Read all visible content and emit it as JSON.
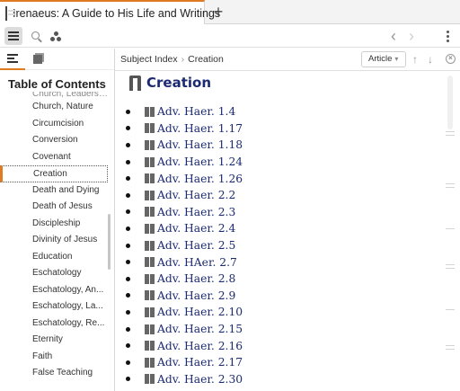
{
  "window": {
    "tab_title": "Irenaeus: A Guide to His Life and Writings",
    "new_tab_symbol": "+"
  },
  "toolbar": {
    "icons": [
      "hamburger-menu-icon",
      "search-icon",
      "triangle-dots-icon",
      "back-icon",
      "forward-icon",
      "more-vertical-icon"
    ],
    "back_symbol": "‹",
    "forward_symbol": "›"
  },
  "sidebar": {
    "title": "Table of Contents",
    "items": [
      {
        "label": "Church, Leadership"
      },
      {
        "label": "Church, Nature"
      },
      {
        "label": "Circumcision"
      },
      {
        "label": "Conversion"
      },
      {
        "label": "Covenant"
      },
      {
        "label": "Creation",
        "selected": true
      },
      {
        "label": "Death and Dying"
      },
      {
        "label": "Death of Jesus"
      },
      {
        "label": "Discipleship"
      },
      {
        "label": "Divinity of Jesus"
      },
      {
        "label": "Education"
      },
      {
        "label": "Eschatology"
      },
      {
        "label": "Eschatology, An..."
      },
      {
        "label": "Eschatology, La..."
      },
      {
        "label": "Eschatology, Re..."
      },
      {
        "label": "Eternity"
      },
      {
        "label": "Faith"
      },
      {
        "label": "False Teaching"
      }
    ]
  },
  "breadcrumb": {
    "parent": "Subject Index",
    "separator": "›",
    "current": "Creation"
  },
  "pane_controls": {
    "view_label": "Article",
    "caret": "▾",
    "up_symbol": "↑",
    "down_symbol": "↓",
    "close_symbol": "×"
  },
  "article": {
    "heading": "Creation",
    "references": [
      "Adv. Haer. 1.4",
      "Adv. Haer. 1.17",
      "Adv. Haer. 1.18",
      "Adv. Haer. 1.24",
      "Adv. Haer. 1.26",
      "Adv. Haer. 2.2",
      "Adv. Haer. 2.3",
      "Adv. Haer. 2.4",
      "Adv. Haer. 2.5",
      "Adv. HAer. 2.7",
      "Adv. Haer. 2.8",
      "Adv. Haer. 2.9",
      "Adv. Haer. 2.10",
      "Adv. Haer. 2.15",
      "Adv. Haer. 2.16",
      "Adv. Haer. 2.17",
      "Adv. Haer. 2.30"
    ]
  },
  "colors": {
    "accent": "#e07b22",
    "link": "#1b2a72"
  }
}
